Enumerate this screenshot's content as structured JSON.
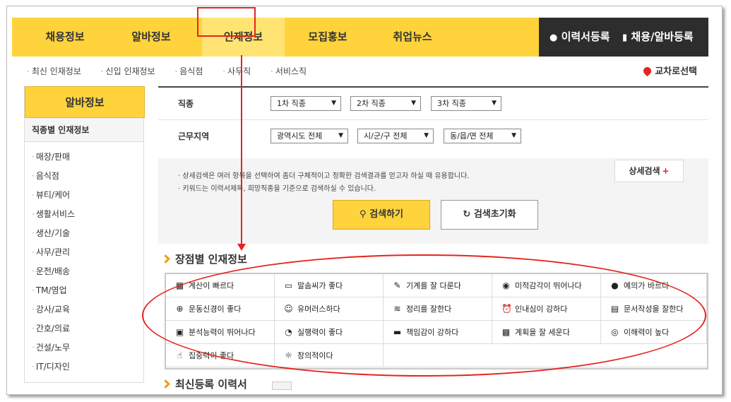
{
  "nav": {
    "items": [
      "채용정보",
      "알바정보",
      "인재정보",
      "모집홍보",
      "취업뉴스"
    ],
    "resume_btn": "이력서등록",
    "job_btn": "채용/알바등록"
  },
  "subnav": {
    "items": [
      "최신 인재정보",
      "신입 인재정보",
      "음식점",
      "사무직",
      "서비스직"
    ],
    "location": "교차로선택"
  },
  "sidebar": {
    "title": "알바정보",
    "subtitle": "직종별 인재정보",
    "items": [
      "매장/판매",
      "음식점",
      "뷰티/케어",
      "생활서비스",
      "생산/기술",
      "사무/관리",
      "운전/배송",
      "TM/영업",
      "강사/교육",
      "간호/의료",
      "건설/노무",
      "IT/디자인"
    ]
  },
  "search": {
    "job_label": "직종",
    "job_selects": [
      "1차 직종",
      "2차 직종",
      "3차 직종"
    ],
    "region_label": "근무지역",
    "region_selects": [
      "광역시도 전체",
      "시/군/구 전체",
      "동/읍/면 전체"
    ],
    "info_lines": [
      "상세검색은 여러 항목을 선택하여 좀더 구체적이고 정확한 검색결과를 얻고자 하실 때 유용합니다.",
      "키워드는 이력서제목, 희망직종을 기준으로 검색하실 수 있습니다."
    ],
    "detail_label": "상세검색",
    "search_btn": "검색하기",
    "reset_btn": "검색초기화"
  },
  "strengths": {
    "title": "장점별 인재정보",
    "items": [
      {
        "label": "계산이 빠르다",
        "icon": "calculator-icon"
      },
      {
        "label": "말솜씨가 좋다",
        "icon": "speech-bubble-icon"
      },
      {
        "label": "기계를 잘 다룬다",
        "icon": "wrench-icon"
      },
      {
        "label": "미적감각이 뛰어나다",
        "icon": "eye-icon"
      },
      {
        "label": "예의가 바르다",
        "icon": "person-icon"
      },
      {
        "label": "운동신경이 좋다",
        "icon": "basketball-icon"
      },
      {
        "label": "유머러스하다",
        "icon": "smile-icon"
      },
      {
        "label": "정리를 잘한다",
        "icon": "layers-icon"
      },
      {
        "label": "인내심이 강하다",
        "icon": "alarm-clock-icon"
      },
      {
        "label": "문서작성을 잘한다",
        "icon": "document-icon"
      },
      {
        "label": "분석능력이 뛰어나다",
        "icon": "presentation-icon"
      },
      {
        "label": "실행력이 좋다",
        "icon": "spinner-icon"
      },
      {
        "label": "책임감이 강하다",
        "icon": "briefcase-icon"
      },
      {
        "label": "계획을 잘 세운다",
        "icon": "calendar-icon"
      },
      {
        "label": "이해력이 높다",
        "icon": "broadcast-icon"
      },
      {
        "label": "집중력이 좋다",
        "icon": "thumbs-up-icon"
      },
      {
        "label": "창의적이다",
        "icon": "sun-icon"
      }
    ]
  },
  "bottom_title": "최신등록 이력서",
  "colors": {
    "accent": "#ffd33c",
    "highlight": "#e52420",
    "dark": "#2d2d2d"
  }
}
